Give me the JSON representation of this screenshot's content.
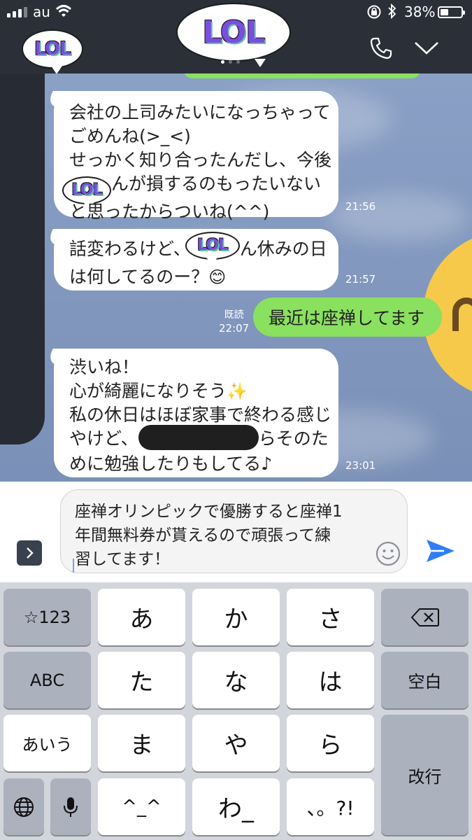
{
  "status_bar": {
    "carrier": "au",
    "battery": "38%",
    "bluetooth": "∗"
  },
  "header": {
    "sticker_text": "LOL",
    "back_sticker_text": "LOL",
    "phone_icon": "phone-icon",
    "collapse_icon": "chevron-down-icon"
  },
  "messages": [
    {
      "side": "left",
      "lines": [
        "会社の上司みたいになっちゃって",
        "ごめんね(>_<)",
        "せっかく知り合ったんだし、今後",
        "んが損するのもったいない",
        "と思ったからついね(^^)"
      ],
      "sticker": "LOL",
      "time": "21:56"
    },
    {
      "side": "left",
      "lines": [
        "話変わるけど、",
        "ん休みの日",
        "は何してるのー？"
      ],
      "sticker": "LOL",
      "emoji": "😊",
      "time": "21:57"
    },
    {
      "side": "right",
      "text": "最近は座禅してます",
      "read_label": "既読",
      "time": "22:07"
    },
    {
      "side": "left",
      "lines": [
        "渋いね！",
        "心が綺麗になりそう",
        "私の休日はほぼ家事で終わる感じ",
        "やけど、",
        "らそのた",
        "めに勉強したりもしてる♪"
      ],
      "emoji": "✨",
      "time": "23:01"
    }
  ],
  "input": {
    "lines": [
      "座禅オリンピックで優勝すると座禅1",
      "年間無料券が貰えるので頑張って練",
      "習してます！"
    ],
    "expand_label": "›",
    "sticker_icon": "smile-icon",
    "send_icon": "send-icon"
  },
  "keyboard": {
    "left": [
      "☆123",
      "ABC",
      "あいう"
    ],
    "grid": [
      [
        "あ",
        "か",
        "さ"
      ],
      [
        "た",
        "な",
        "は"
      ],
      [
        "ま",
        "や",
        "ら"
      ],
      [
        "^_^",
        "わ_",
        "、。?!"
      ]
    ],
    "right": [
      "⌫",
      "空白",
      "改行"
    ],
    "globe_icon": "globe-icon",
    "mic_icon": "microphone-icon"
  },
  "colors": {
    "header_bg": "#2b2f38",
    "my_bubble": "#8ae05f",
    "chat_bg": "#8399bf",
    "send_blue": "#2f7ef5",
    "sticker_purple": "#7b4de0"
  }
}
